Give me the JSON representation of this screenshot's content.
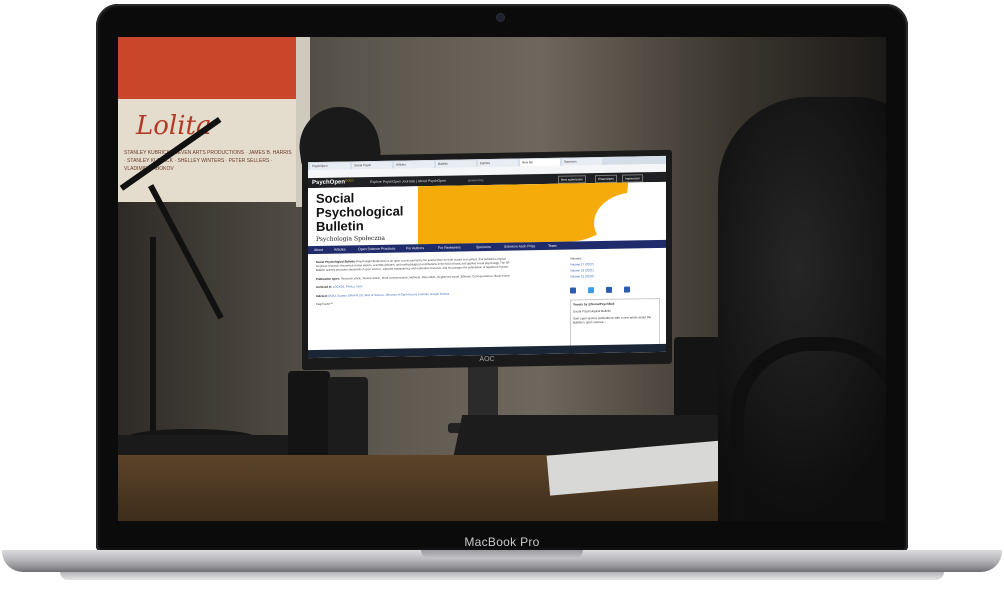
{
  "device": {
    "label": "MacBook Pro"
  },
  "photo": {
    "poster": {
      "title": "Lolita",
      "credits": "STANLEY KUBRICK · SEVEN ARTS PRODUCTIONS · JAMES B. HARRIS · STANLEY KUBRICK · SHELLEY WINTERS · PETER SELLERS · VLADIMIR NABOKOV"
    },
    "monitor_logo": "AOC"
  },
  "webpage": {
    "tabs": [
      "PsychOpen",
      "Social Psych",
      "Articles",
      "Bulletin",
      "Explore",
      "New tab",
      "Sponsors"
    ],
    "topnav": {
      "logo": "PsychOpen",
      "gold": "GOLD",
      "links": "Explore PsychOpen Journals | About PsychOpen",
      "powered": "powered by",
      "buttons": [
        "New submission",
        "Email Alerts",
        "Impressum"
      ]
    },
    "journal_title": "Social\nPsychological\nBulletin",
    "journal_subtitle": "Psychologia Społeczna",
    "nav": [
      "About",
      "Articles",
      "Open Science Practices",
      "For Authors",
      "For Reviewers",
      "Sponsors",
      "Solomon Asch Prize",
      "Team"
    ],
    "intro_label": "Social Psychological Bulletin",
    "intro_text": "(Psychologia Społeczna) is an open access journal by the journal (free for both reader and author), that publishes original empirical research, theoretical review papers, scientific debates, and methodological contributions in the field of basic and applied social psychology. The SP Bulletin actively promotes standards of open science, supports transparency and replication research, and encourages the submission of registered reports.",
    "publication_types_label": "Publication types:",
    "publication_types": "Research article, Review article, Short communication, Methods, Data article, Registered report, Editorial, Correspondence, Book review",
    "archived_label": "Archived in:",
    "archived": "LOCKSS, Portico, more",
    "indexed_label": "Indexed:",
    "indexed": "DOAJ, Scopus, ERIH PLUS, Web of Science, Directory of Open Access Journals, Google Scholar",
    "flag_factor": "Flag Factor™",
    "sidebar": {
      "title": "Volumes",
      "items": [
        "Volume 17 (2022)",
        "Volume 16 (2021)",
        "Volume 15 (2020)"
      ]
    },
    "tweets_title": "Tweets by @SocialPsychBull",
    "tweet_author": "Social Psychological Bulletin",
    "tweet_text": "Gain open-access publications with a new article about the Bulletin's open science..."
  }
}
